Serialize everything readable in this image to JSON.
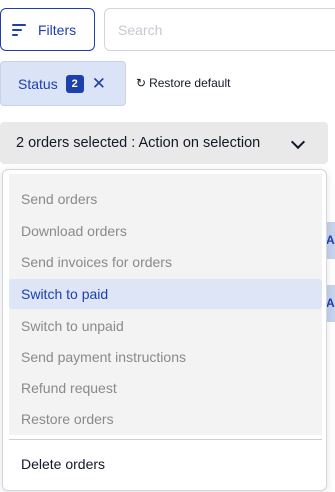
{
  "toolbar": {
    "filters_label": "Filters",
    "search_placeholder": "Search"
  },
  "filter_chip": {
    "label": "Status",
    "count": "2",
    "remove_glyph": "✕"
  },
  "restore": {
    "icon": "↻",
    "label": "Restore default"
  },
  "action_bar": {
    "label": "2 orders selected : Action on selection"
  },
  "menu": {
    "items": [
      {
        "label": "Send orders"
      },
      {
        "label": "Download orders"
      },
      {
        "label": "Send invoices for orders"
      },
      {
        "label": "Switch to paid"
      },
      {
        "label": "Switch to unpaid"
      },
      {
        "label": "Send payment instructions"
      },
      {
        "label": "Refund request"
      },
      {
        "label": "Restore orders"
      }
    ],
    "delete_label": "Delete orders"
  },
  "colors": {
    "accent": "#1e40af",
    "chip_bg": "#dbe4f7",
    "active_item_bg": "#dde5f7",
    "action_bar_bg": "#e9e9e9"
  }
}
